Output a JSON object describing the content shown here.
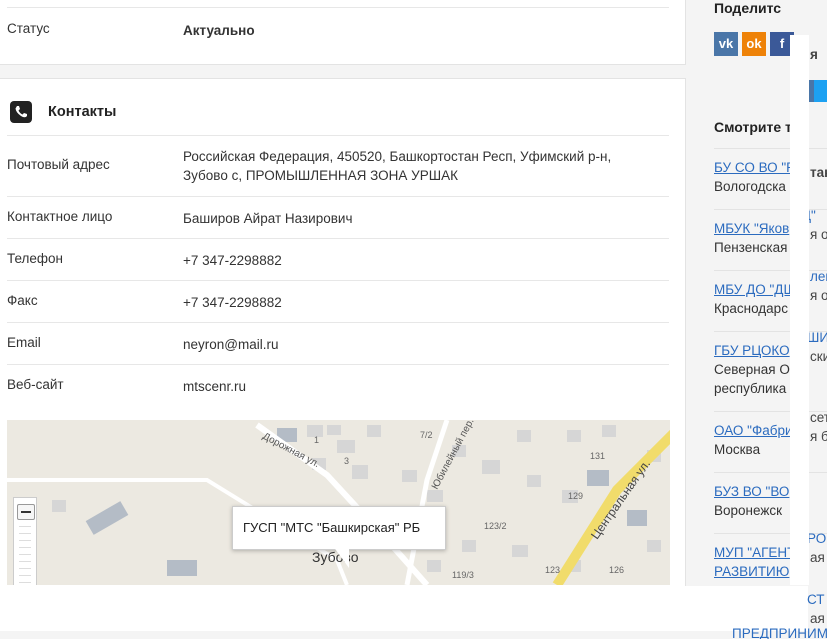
{
  "status": {
    "label": "Статус",
    "value": "Актуально"
  },
  "contacts": {
    "title": "Контакты",
    "rows": [
      {
        "label": "Почтовый адрес",
        "value": "Российская Федерация, 450520, Башкортостан Респ, Уфимский р-н,",
        "value2": "Зубово с, ПРОМЫШЛЕННАЯ ЗОНА УРШАК"
      },
      {
        "label": "Контактное лицо",
        "value": "Баширов Айрат Назирович"
      },
      {
        "label": "Телефон",
        "value": "+7 347-2298882"
      },
      {
        "label": "Факс",
        "value": "+7 347-2298882"
      },
      {
        "label": "Email",
        "value": "neyron@mail.ru"
      },
      {
        "label": "Веб-сайт",
        "value": "mtscenr.ru"
      }
    ],
    "map": {
      "popup": "ГУСП \"МТС \"Башкирская\" РБ",
      "labels": {
        "s1": "Дорожная ул.",
        "s2": "Юбилейный пер.",
        "s3": "Центральная ул.",
        "town": "Зубово",
        "n1": "1",
        "n2": "3",
        "n3": "7/2",
        "n4": "131",
        "n5": "129",
        "n6": "123/2",
        "n7": "123",
        "n8": "126",
        "n9": "119/3"
      }
    }
  },
  "sidebar": {
    "share_title": "Поделитс",
    "social": [
      "vk",
      "ok",
      "f"
    ],
    "see_title": "Смотрите т",
    "items": [
      {
        "link": "БУ СО ВО \"Р",
        "sub": "Вологодска"
      },
      {
        "link": "МБУК \"Яков",
        "sub": "Пензенская"
      },
      {
        "link": "МБУ ДО \"ДШ",
        "sub": "Краснодарс"
      },
      {
        "link": "ГБУ РЦОКО",
        "sub": "Северная О",
        "sub2": "республика"
      },
      {
        "link": "ОАО \"Фабри",
        "sub": "Москва"
      },
      {
        "link": "БУЗ ВО \"ВО",
        "sub": "Воронежск"
      },
      {
        "link": "МУП \"АГЕНТ",
        "link2": "РАЗВИТИЮ"
      }
    ],
    "peek": [
      "я",
      "так",
      "РЦ\"",
      "я о",
      "лен",
      "я об",
      "ШИ",
      "ски",
      "сет",
      "я ба",
      "РОР",
      "ая о",
      "СТ",
      "ая о",
      "ПРЕДПРИНИМ"
    ]
  }
}
